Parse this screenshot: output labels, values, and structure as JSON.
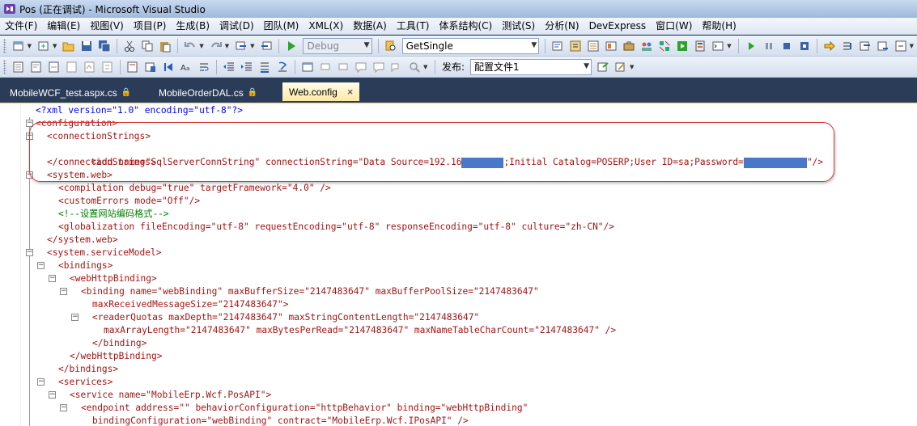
{
  "window": {
    "title": "Pos (正在调试) - Microsoft Visual Studio"
  },
  "menu": [
    "文件(F)",
    "编辑(E)",
    "视图(V)",
    "项目(P)",
    "生成(B)",
    "调试(D)",
    "团队(M)",
    "XML(X)",
    "数据(A)",
    "工具(T)",
    "体系结构(C)",
    "测试(S)",
    "分析(N)",
    "DevExpress",
    "窗口(W)",
    "帮助(H)"
  ],
  "toolbar": {
    "config_combo": "Debug",
    "find_combo": "GetSingle",
    "publish_label": "发布:",
    "publish_combo": "配置文件1"
  },
  "tabs": [
    {
      "label": "MobileWCF_test.aspx.cs",
      "lock": "🔒"
    },
    {
      "label": "MobileOrderDAL.cs",
      "lock": "🔒"
    },
    {
      "label": "Web.config",
      "close": "×"
    }
  ],
  "code": [
    "<?xml version=\"1.0\" encoding=\"utf-8\"?>",
    "<configuration>",
    "<connectionStrings>",
    "<add name=\"SqlServerConnString\" connectionString=\"Data Source=192.16",
    ";Initial Catalog=POSERP;User ID=sa;Password=",
    "\"/>",
    "</connectionStrings>",
    "<system.web>",
    "<compilation debug=\"true\" targetFramework=\"4.0\" />",
    "<customErrors mode=\"Off\"/>",
    "<!--设置网站编码格式-->",
    "<globalization fileEncoding=\"utf-8\" requestEncoding=\"utf-8\" responseEncoding=\"utf-8\" culture=\"zh-CN\"/>",
    "</system.web>",
    "<system.serviceModel>",
    "<bindings>",
    "<webHttpBinding>",
    "<binding name=\"webBinding\" maxBufferSize=\"2147483647\" maxBufferPoolSize=\"2147483647\"",
    "maxReceivedMessageSize=\"2147483647\">",
    "<readerQuotas maxDepth=\"2147483647\" maxStringContentLength=\"2147483647\"",
    "maxArrayLength=\"2147483647\" maxBytesPerRead=\"2147483647\" maxNameTableCharCount=\"2147483647\" />",
    "</binding>",
    "</webHttpBinding>",
    "</bindings>",
    "<services>",
    "<service name=\"MobileErp.Wcf.PosAPI\">",
    "<endpoint address=\"\" behaviorConfiguration=\"httpBehavior\" binding=\"webHttpBinding\"",
    "bindingConfiguration=\"webBinding\" contract=\"MobileErp.Wcf.IPosAPI\" />"
  ],
  "colors": {
    "accent": "#2b3c59",
    "highlight": "#d33333",
    "redaction": "#4a78c8"
  }
}
